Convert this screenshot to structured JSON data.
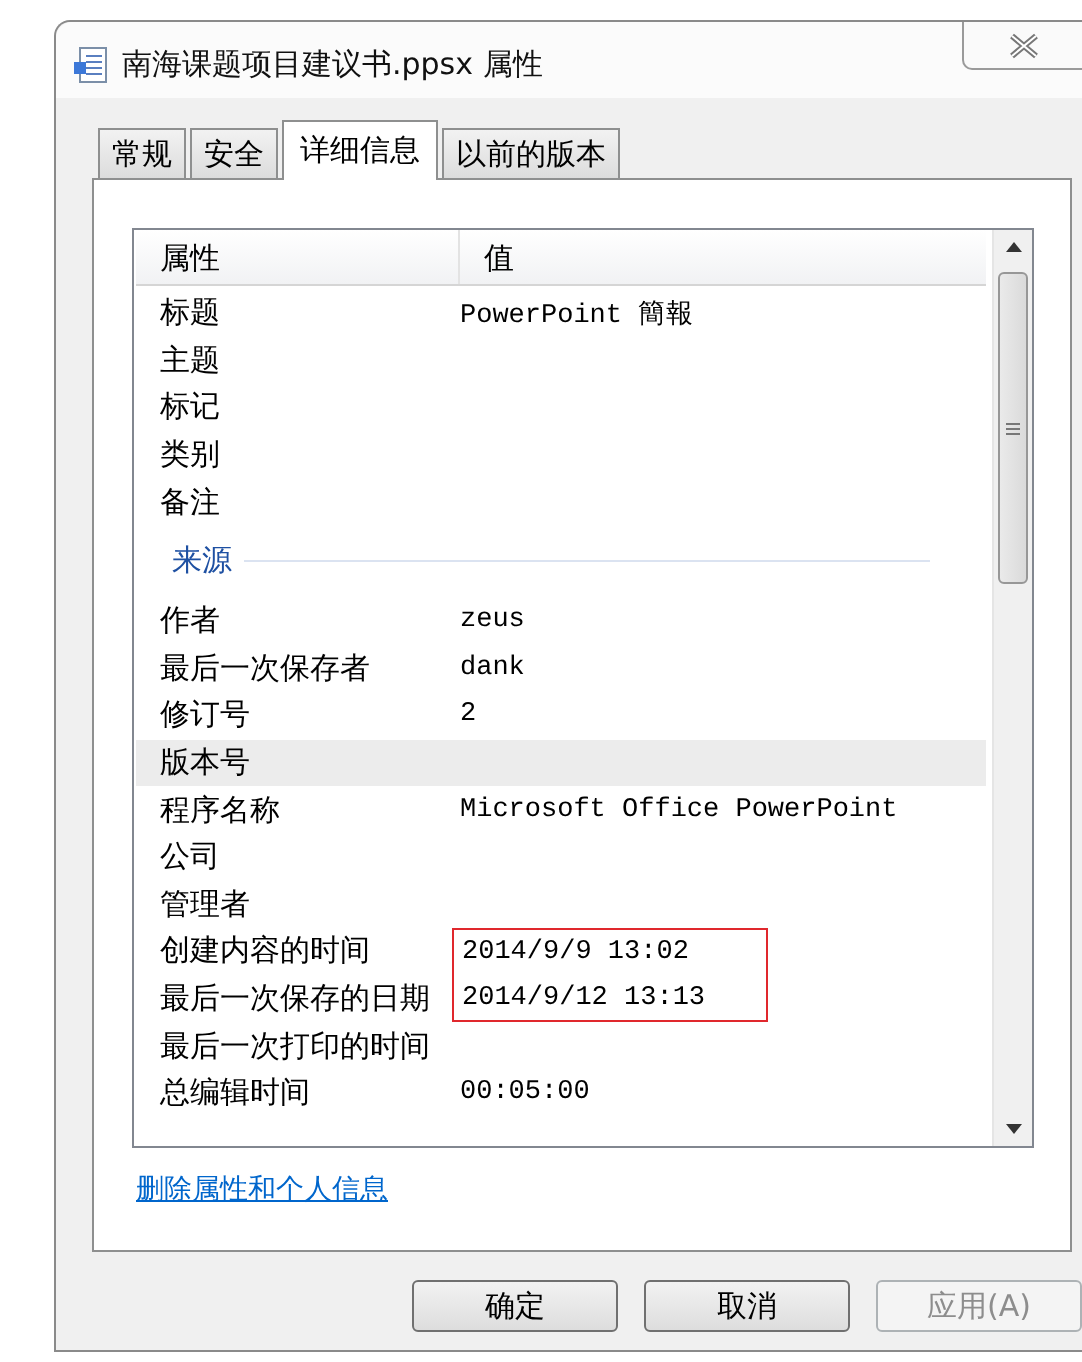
{
  "window": {
    "title": "南海课题项目建议书.ppsx 属性"
  },
  "tabs": [
    {
      "label": "常规",
      "selected": false
    },
    {
      "label": "安全",
      "selected": false
    },
    {
      "label": "详细信息",
      "selected": true
    },
    {
      "label": "以前的版本",
      "selected": false
    }
  ],
  "properties": {
    "columns": [
      "属性",
      "值"
    ],
    "rows": [
      {
        "kind": "property",
        "name": "标题",
        "value": "PowerPoint 簡報",
        "selected": false,
        "boxed": false
      },
      {
        "kind": "property",
        "name": "主题",
        "selected": false,
        "boxed": false
      },
      {
        "kind": "property",
        "name": "标记",
        "selected": false,
        "boxed": false
      },
      {
        "kind": "property",
        "name": "类别",
        "selected": false,
        "boxed": false
      },
      {
        "kind": "property",
        "name": "备注",
        "selected": false,
        "boxed": false
      },
      {
        "kind": "group",
        "name": "来源"
      },
      {
        "kind": "property",
        "name": "作者",
        "value": "zeus",
        "selected": false,
        "boxed": false
      },
      {
        "kind": "property",
        "name": "最后一次保存者",
        "value": "dank",
        "selected": false,
        "boxed": false
      },
      {
        "kind": "property",
        "name": "修订号",
        "value": "2",
        "selected": false,
        "boxed": false
      },
      {
        "kind": "property",
        "name": "版本号",
        "selected": true,
        "boxed": false
      },
      {
        "kind": "property",
        "name": "程序名称",
        "value": "Microsoft Office PowerPoint",
        "selected": false,
        "boxed": false
      },
      {
        "kind": "property",
        "name": "公司",
        "selected": false,
        "boxed": false
      },
      {
        "kind": "property",
        "name": "管理者",
        "selected": false,
        "boxed": false
      },
      {
        "kind": "property",
        "name": "创建内容的时间",
        "value": "2014/9/9 13:02",
        "selected": false,
        "boxed": true
      },
      {
        "kind": "property",
        "name": "最后一次保存的日期",
        "value": "2014/9/12 13:13",
        "selected": false,
        "boxed": true
      },
      {
        "kind": "property",
        "name": "最后一次打印的时间",
        "selected": false,
        "boxed": false
      },
      {
        "kind": "property",
        "name": "总编辑时间",
        "value": "00:05:00",
        "selected": false,
        "boxed": false
      }
    ]
  },
  "link": "删除属性和个人信息",
  "buttons": [
    {
      "label": "确定",
      "disabled": false
    },
    {
      "label": "取消",
      "disabled": false
    },
    {
      "label": "应用(A)",
      "disabled": true
    }
  ]
}
